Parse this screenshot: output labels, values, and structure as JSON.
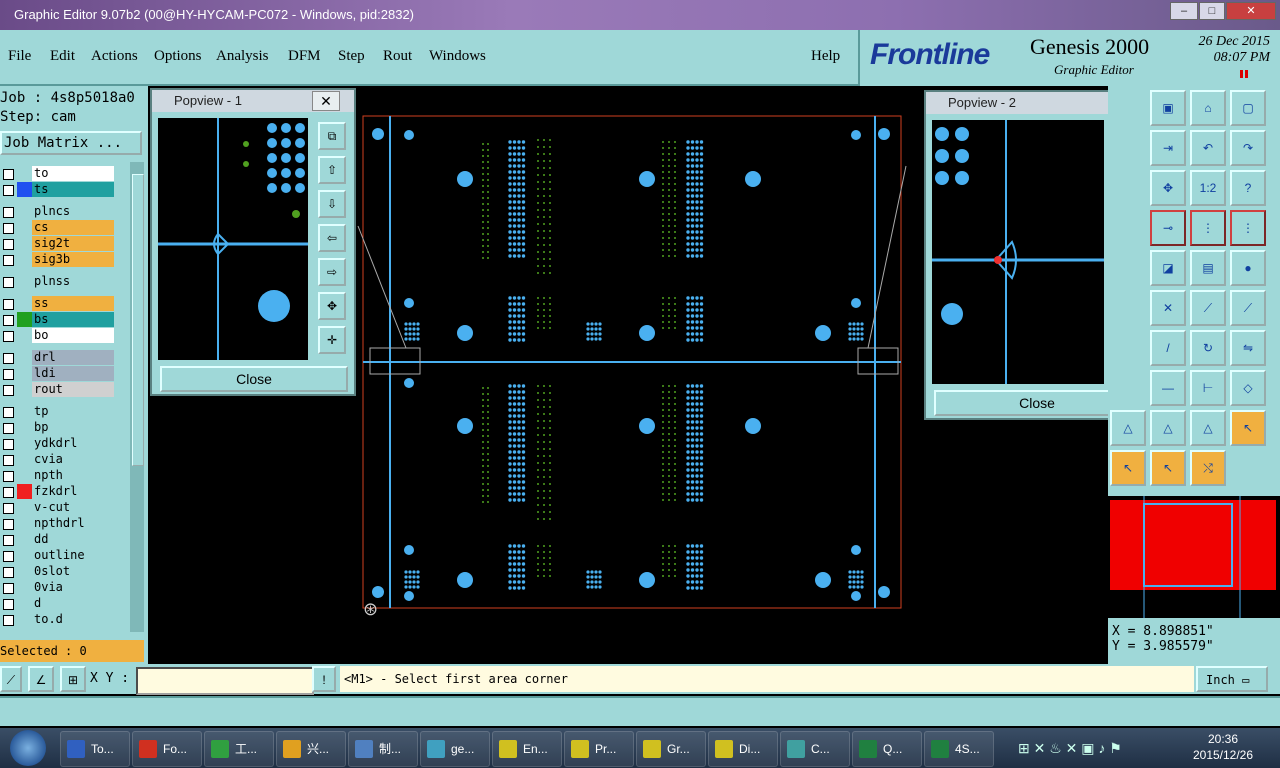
{
  "window": {
    "title": "Graphic Editor 9.07b2 (00@HY-HYCAM-PC072 - Windows, pid:2832)"
  },
  "menu": [
    "File",
    "Edit",
    "Actions",
    "Options",
    "Analysis",
    "DFM",
    "Step",
    "Rout",
    "Windows"
  ],
  "help": "Help",
  "brand": {
    "logo": "Frontline",
    "product": "Genesis 2000",
    "subtitle": "Graphic Editor",
    "date": "26 Dec 2015",
    "time": "08:07 PM"
  },
  "job": {
    "job_line": "Job : 4s8p5018a0",
    "step_line": "Step: cam",
    "matrix_button": "Job Matrix ..."
  },
  "layers": [
    {
      "name": "to",
      "color": "#ffffff",
      "swatch": "#9fd8d8"
    },
    {
      "name": "ts",
      "color": "#20a0a0",
      "swatch": "#2050f0"
    },
    {
      "name": "plncs",
      "color": "#9fd8d8",
      "swatch": "#9fd8d8"
    },
    {
      "name": "cs",
      "color": "#f0b040",
      "swatch": "#9fd8d8"
    },
    {
      "name": "sig2t",
      "color": "#f0b040",
      "swatch": "#9fd8d8"
    },
    {
      "name": "sig3b",
      "color": "#f0b040",
      "swatch": "#9fd8d8"
    },
    {
      "name": "plnss",
      "color": "#9fd8d8",
      "swatch": "#9fd8d8"
    },
    {
      "name": "ss",
      "color": "#f0b040",
      "swatch": "#9fd8d8"
    },
    {
      "name": "bs",
      "color": "#20a0a0",
      "swatch": "#20a020"
    },
    {
      "name": "bo",
      "color": "#ffffff",
      "swatch": "#9fd8d8"
    },
    {
      "name": "drl",
      "color": "#a0b0c0",
      "swatch": "#9fd8d8"
    },
    {
      "name": "ldi",
      "color": "#a0b0c0",
      "swatch": "#9fd8d8"
    },
    {
      "name": "rout",
      "color": "#d0d0d0",
      "swatch": "#9fd8d8"
    },
    {
      "name": "tp",
      "color": "#9fd8d8",
      "swatch": "#9fd8d8"
    },
    {
      "name": "bp",
      "color": "#9fd8d8",
      "swatch": "#9fd8d8"
    },
    {
      "name": "ydkdrl",
      "color": "#9fd8d8",
      "swatch": "#9fd8d8"
    },
    {
      "name": "cvia",
      "color": "#9fd8d8",
      "swatch": "#9fd8d8"
    },
    {
      "name": "npth",
      "color": "#9fd8d8",
      "swatch": "#9fd8d8"
    },
    {
      "name": "fzkdrl",
      "color": "#9fd8d8",
      "swatch": "#f02020"
    },
    {
      "name": "v-cut",
      "color": "#9fd8d8",
      "swatch": "#9fd8d8"
    },
    {
      "name": "npthdrl",
      "color": "#9fd8d8",
      "swatch": "#9fd8d8"
    },
    {
      "name": "dd",
      "color": "#9fd8d8",
      "swatch": "#9fd8d8"
    },
    {
      "name": "outline",
      "color": "#9fd8d8",
      "swatch": "#9fd8d8"
    },
    {
      "name": "0slot",
      "color": "#9fd8d8",
      "swatch": "#9fd8d8"
    },
    {
      "name": "0via",
      "color": "#9fd8d8",
      "swatch": "#9fd8d8"
    },
    {
      "name": "d",
      "color": "#9fd8d8",
      "swatch": "#9fd8d8"
    },
    {
      "name": "to.d",
      "color": "#9fd8d8",
      "swatch": "#9fd8d8"
    }
  ],
  "selected": "Selected : 0",
  "popview1": {
    "title": "Popview - 1",
    "close": "Close"
  },
  "popview2": {
    "title": "Popview - 2",
    "close": "Close"
  },
  "coords": {
    "x": "X = 8.898851\"",
    "y": "Y = 3.985579\""
  },
  "command": {
    "xy_label": "X Y :",
    "xy_value": "",
    "prompt": "<M1> - Select first area corner",
    "units": "Inch"
  },
  "taskbar": {
    "items": [
      "To...",
      "Fo...",
      "工...",
      "兴...",
      "制...",
      "ge...",
      "En...",
      "Pr...",
      "Gr...",
      "Di...",
      "C...",
      "Q...",
      "4S..."
    ],
    "clock_time": "20:36",
    "clock_date": "2015/12/26"
  },
  "colors": {
    "panel": "#9fd8d8",
    "feature": "#4ab0f0",
    "pad_green": "#50a020",
    "profile": "#d04020"
  }
}
